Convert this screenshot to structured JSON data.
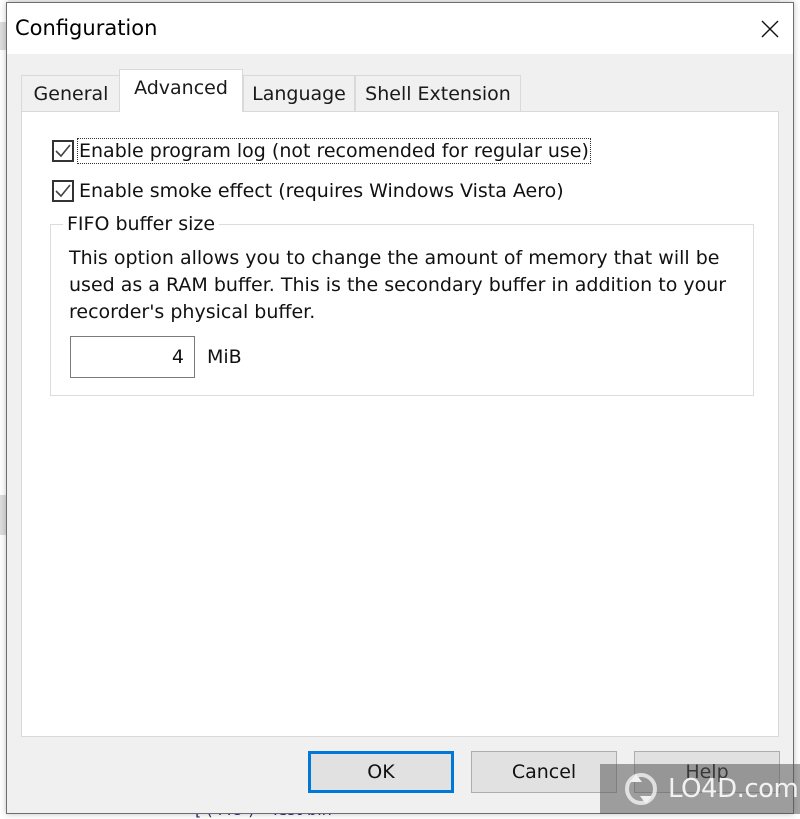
{
  "background": {
    "bottom_text": "[ ( MU ) - Test bin"
  },
  "dialog": {
    "title": "Configuration",
    "close_icon": "close-x-icon"
  },
  "tabs": [
    {
      "label": "General",
      "active": false
    },
    {
      "label": "Advanced",
      "active": true
    },
    {
      "label": "Language",
      "active": false
    },
    {
      "label": "Shell Extension",
      "active": false
    }
  ],
  "advanced": {
    "options": [
      {
        "label": "Enable program log (not recomended for regular use)",
        "checked": true,
        "focused": true
      },
      {
        "label": "Enable smoke effect (requires Windows Vista Aero)",
        "checked": true,
        "focused": false
      }
    ],
    "fifo": {
      "legend": "FIFO buffer size",
      "description": "This option allows you to change the amount of memory that will be used as a RAM buffer. This is the secondary buffer in addition to your recorder's physical buffer.",
      "value": "4",
      "unit": "MiB"
    }
  },
  "buttons": {
    "ok": "OK",
    "cancel": "Cancel",
    "help": "Help"
  },
  "colors": {
    "accent": "#0078d7",
    "dialog_bg": "#f0f0f0"
  },
  "watermark": {
    "text": "LO4D.com"
  }
}
